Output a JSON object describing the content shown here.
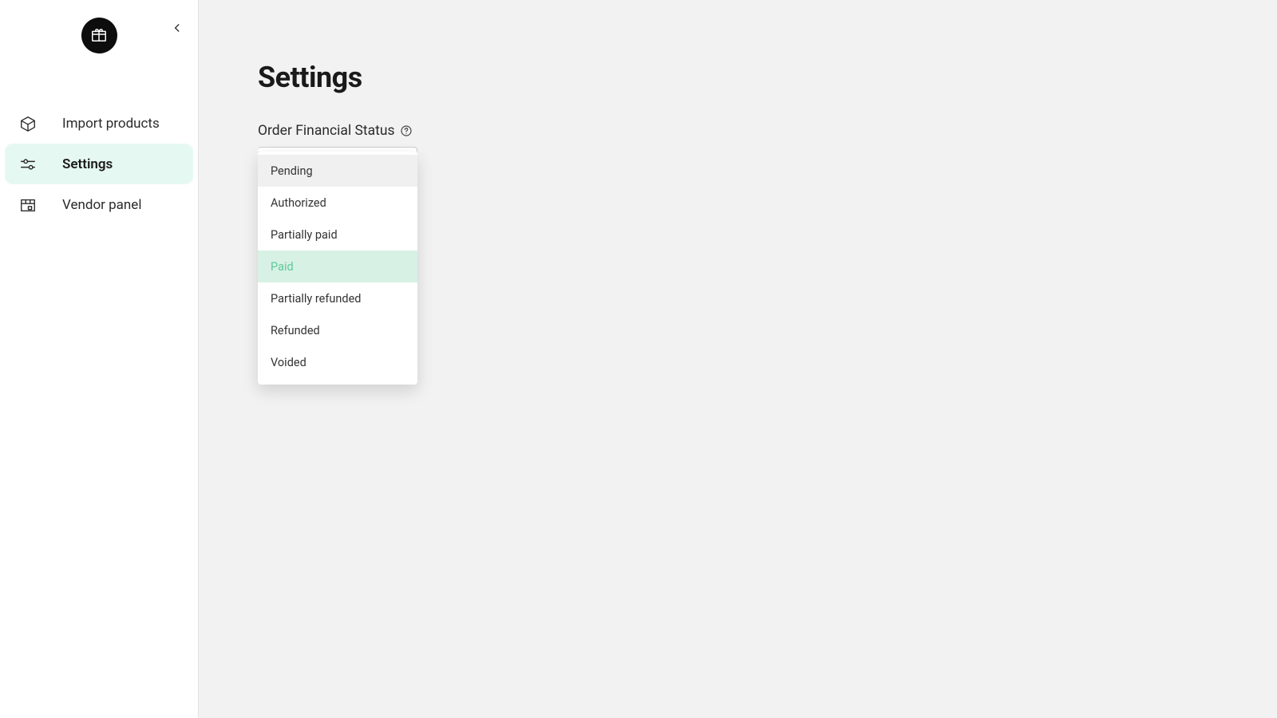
{
  "sidebar": {
    "items": [
      {
        "label": "Import products"
      },
      {
        "label": "Settings"
      },
      {
        "label": "Vendor panel"
      }
    ],
    "active_index": 1
  },
  "page": {
    "title": "Settings",
    "field_label": "Order Financial Status"
  },
  "dropdown": {
    "options": [
      "Pending",
      "Authorized",
      "Partially paid",
      "Paid",
      "Partially refunded",
      "Refunded",
      "Voided"
    ],
    "selected_index": 3,
    "hover_index": 0
  },
  "colors": {
    "accent_bg": "#d7f1e4",
    "accent_text": "#5fc89a",
    "sidebar_active": "#e6f8f2"
  }
}
